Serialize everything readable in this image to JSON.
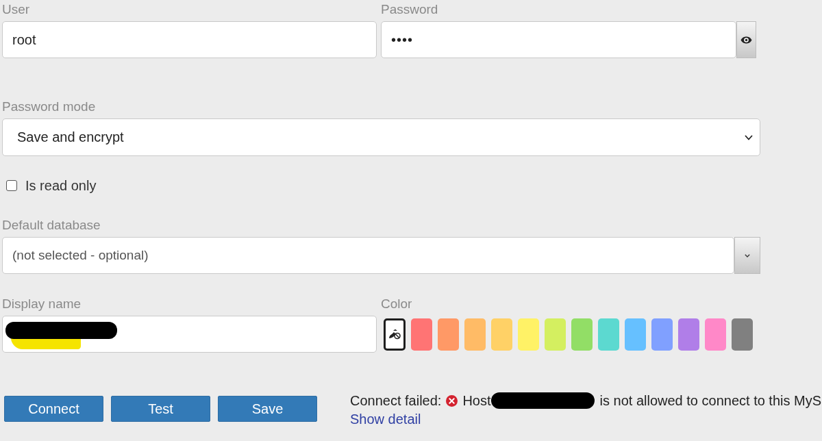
{
  "credentials": {
    "user": {
      "label": "User",
      "value": "root"
    },
    "password": {
      "label": "Password",
      "value": "••••"
    }
  },
  "password_mode": {
    "label": "Password mode",
    "value": "Save and encrypt"
  },
  "read_only": {
    "label": "Is read only",
    "checked": false
  },
  "default_database": {
    "label": "Default database",
    "placeholder": "(not selected - optional)"
  },
  "display_name": {
    "label": "Display name",
    "redacted": true
  },
  "color": {
    "label": "Color",
    "swatches": [
      {
        "kind": "none",
        "selected": true
      },
      {
        "kind": "color",
        "color": "#ff7474",
        "selected": false
      },
      {
        "kind": "color",
        "color": "#ff9966",
        "selected": false
      },
      {
        "kind": "color",
        "color": "#ffbb66",
        "selected": false
      },
      {
        "kind": "color",
        "color": "#ffd166",
        "selected": false
      },
      {
        "kind": "color",
        "color": "#fff266",
        "selected": false
      },
      {
        "kind": "color",
        "color": "#d4ef60",
        "selected": false
      },
      {
        "kind": "color",
        "color": "#92de66",
        "selected": false
      },
      {
        "kind": "color",
        "color": "#5cd9d0",
        "selected": false
      },
      {
        "kind": "color",
        "color": "#66c0ff",
        "selected": false
      },
      {
        "kind": "color",
        "color": "#80a0ff",
        "selected": false
      },
      {
        "kind": "color",
        "color": "#b07ee8",
        "selected": false
      },
      {
        "kind": "color",
        "color": "#ff88c8",
        "selected": false
      },
      {
        "kind": "color",
        "color": "#808080",
        "selected": false
      }
    ]
  },
  "buttons": [
    {
      "label": "Connect"
    },
    {
      "label": "Test"
    },
    {
      "label": "Save"
    }
  ],
  "status": {
    "prefix": "Connect failed:",
    "error": true,
    "host_label": "Host",
    "host_redacted": true,
    "message": "is not allowed to connect to this MyS",
    "link": "Show detail"
  }
}
